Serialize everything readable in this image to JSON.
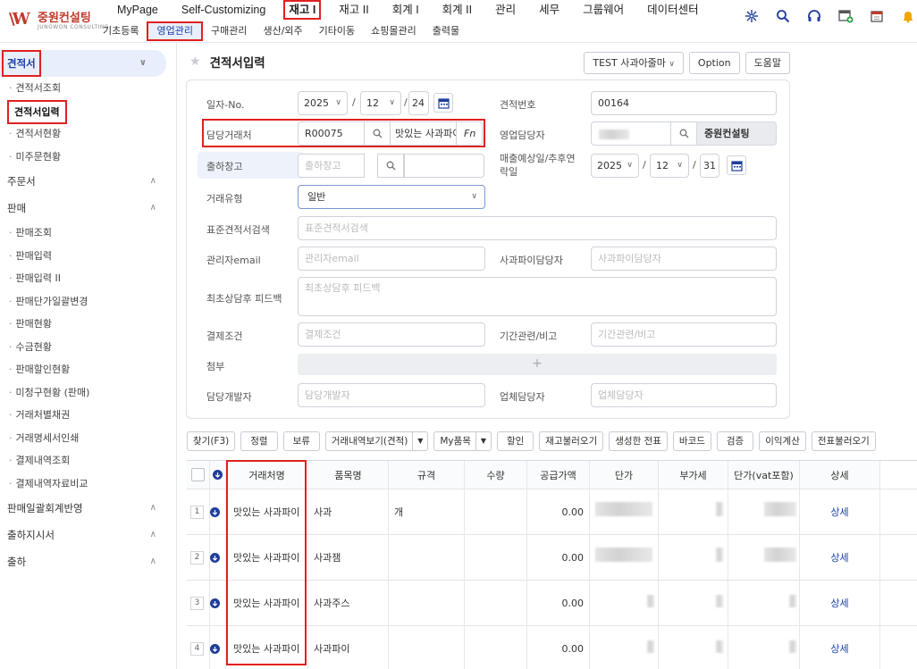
{
  "app": {
    "logo_text": "중원컨설팅",
    "logo_sub": "JUNGWON CONSULTING"
  },
  "main_menu": [
    {
      "label": "MyPage"
    },
    {
      "label": "Self-Customizing"
    },
    {
      "label": "재고 I",
      "active": true
    },
    {
      "label": "재고 II"
    },
    {
      "label": "회계 I"
    },
    {
      "label": "회계 II"
    },
    {
      "label": "관리"
    },
    {
      "label": "세무"
    },
    {
      "label": "그룹웨어"
    },
    {
      "label": "데이터센터"
    }
  ],
  "sub_menu": [
    {
      "label": "기초등록"
    },
    {
      "label": "영업관리",
      "active": true
    },
    {
      "label": "구매관리"
    },
    {
      "label": "생산/외주"
    },
    {
      "label": "기타이동"
    },
    {
      "label": "쇼핑몰관리"
    },
    {
      "label": "출력물"
    }
  ],
  "top_icons": [
    "network-icon",
    "search-icon",
    "headset-icon",
    "add-window-icon",
    "calendar-icon",
    "bell-icon"
  ],
  "sidebar": {
    "groups": [
      {
        "label": "견적서",
        "active": true,
        "items": [
          {
            "label": "견적서조회"
          },
          {
            "label": "견적서입력",
            "current": true
          },
          {
            "label": "견적서현황"
          },
          {
            "label": "미주문현황"
          }
        ]
      },
      {
        "label": "주문서",
        "items": []
      },
      {
        "label": "판매",
        "items": [
          {
            "label": "판매조회"
          },
          {
            "label": "판매입력"
          },
          {
            "label": "판매입력 II"
          },
          {
            "label": "판매단가일괄변경"
          },
          {
            "label": "판매현황"
          },
          {
            "label": "수금현황"
          },
          {
            "label": "판매할인현황"
          },
          {
            "label": "미청구현황 (판매)"
          },
          {
            "label": "거래처별채권"
          },
          {
            "label": "거래명세서인쇄"
          },
          {
            "label": "결제내역조회"
          },
          {
            "label": "결제내역자료비교"
          }
        ]
      },
      {
        "label": "판매일괄회계반영",
        "items": []
      },
      {
        "label": "출하지시서",
        "items": []
      },
      {
        "label": "출하",
        "items": []
      }
    ]
  },
  "page": {
    "title": "견적서입력",
    "header_buttons": {
      "template": "TEST 사과아줄마",
      "option": "Option",
      "help": "도움말"
    }
  },
  "form": {
    "date_label": "일자-No.",
    "date_year": "2025",
    "date_month": "12",
    "date_day": "24",
    "estimate_no_label": "견적번호",
    "estimate_no": "00164",
    "customer_label": "담당거래처",
    "customer_code": "R00075",
    "customer_name": "맛있는 사과파이",
    "fn_label": "Fn",
    "sales_manager_label": "영업담당자",
    "sales_manager_name": "중원컨설팅",
    "warehouse_label": "출하창고",
    "warehouse_placeholder": "출하창고",
    "expected_date_label": "매출예상일/추후연락일",
    "expected_year": "2025",
    "expected_month": "12",
    "expected_day": "31",
    "trade_type_label": "거래유형",
    "trade_type": "일반",
    "standard_search_label": "표준견적서검색",
    "standard_search_placeholder": "표준견적서검색",
    "admin_email_label": "관리자email",
    "admin_email_placeholder": "관리자email",
    "pie_manager_label": "사과파이담당자",
    "pie_manager_placeholder": "사과파이담당자",
    "feedback_label": "최초상담후 피드백",
    "feedback_placeholder": "최초상담후 피드백",
    "payment_label": "결제조건",
    "payment_placeholder": "결제조건",
    "period_label": "기간관련/비고",
    "period_placeholder": "기간관련/비고",
    "attach_label": "첨부",
    "attach_plus": "+",
    "developer_label": "담당개발자",
    "developer_placeholder": "담당개발자",
    "vendor_manager_label": "업체담당자",
    "vendor_manager_placeholder": "업체담당자"
  },
  "toolbar": [
    {
      "label": "찾기(F3)"
    },
    {
      "label": "정렬"
    },
    {
      "label": "보류"
    },
    {
      "label": "거래내역보기(견적)",
      "split": true
    },
    {
      "label": "My품목",
      "split": true
    },
    {
      "label": "할인"
    },
    {
      "label": "재고불러오기"
    },
    {
      "label": "생성한 전표"
    },
    {
      "label": "바코드"
    },
    {
      "label": "검증"
    },
    {
      "label": "이익계산"
    },
    {
      "label": "전표불러오기"
    }
  ],
  "grid": {
    "columns": [
      "거래처명",
      "품목명",
      "규격",
      "수량",
      "공급가액",
      "단가",
      "부가세",
      "단가(vat포함)",
      "상세"
    ],
    "rows": [
      {
        "num": "1",
        "customer": "맛있는 사과파이",
        "item": "사과",
        "spec": "개",
        "qty": "",
        "supply": "0.00",
        "detail": "상세"
      },
      {
        "num": "2",
        "customer": "맛있는 사과파이",
        "item": "사과잼",
        "spec": "",
        "qty": "",
        "supply": "0.00",
        "detail": "상세"
      },
      {
        "num": "3",
        "customer": "맛있는 사과파이",
        "item": "사과주스",
        "spec": "",
        "qty": "",
        "supply": "0.00",
        "detail": "상세"
      },
      {
        "num": "4",
        "customer": "맛있는 사과파이",
        "item": "사과파이",
        "spec": "",
        "qty": "",
        "supply": "0.00",
        "detail": "상세"
      }
    ]
  },
  "colors": {
    "accent": "#1a3fa6",
    "highlight_red": "#e02020",
    "active_bg": "#e8eefc"
  }
}
